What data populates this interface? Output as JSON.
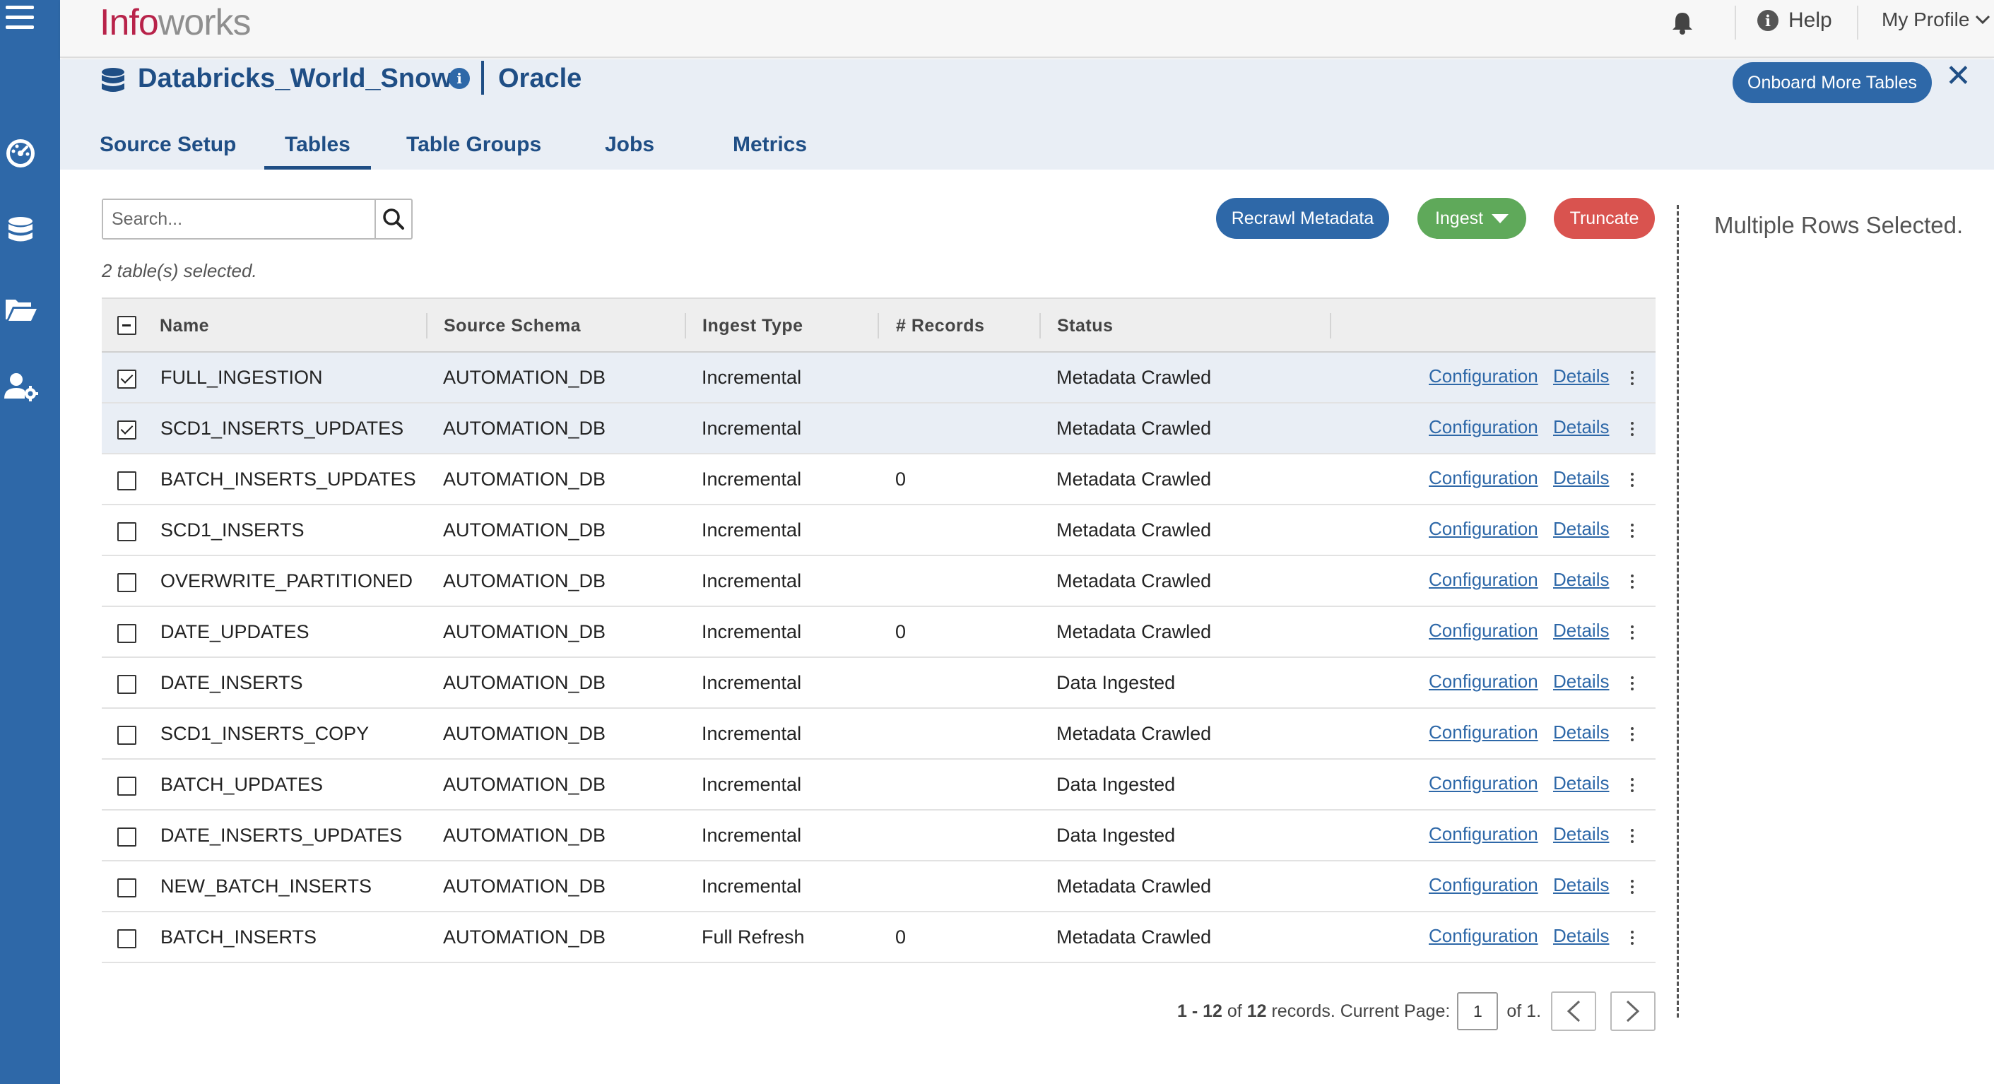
{
  "app": {
    "logo_part1": "Info",
    "logo_part2": "works"
  },
  "header": {
    "help_label": "Help",
    "profile_label": "My Profile"
  },
  "source": {
    "name": "Databricks_World_Snow",
    "type": "Oracle",
    "onboard_label": "Onboard More Tables",
    "close_label": "✕"
  },
  "tabs": [
    {
      "label": "Source Setup",
      "active": false
    },
    {
      "label": "Tables",
      "active": true
    },
    {
      "label": "Table Groups",
      "active": false
    },
    {
      "label": "Jobs",
      "active": false
    },
    {
      "label": "Metrics",
      "active": false
    }
  ],
  "toolbar": {
    "search_placeholder": "Search...",
    "selected_note": "2 table(s) selected.",
    "recrawl_label": "Recrawl Metadata",
    "ingest_label": "Ingest",
    "truncate_label": "Truncate"
  },
  "table": {
    "columns": [
      "Name",
      "Source Schema",
      "Ingest Type",
      "# Records",
      "Status"
    ],
    "config_label": "Configuration",
    "details_label": "Details",
    "rows": [
      {
        "name": "FULL_INGESTION",
        "schema": "AUTOMATION_DB",
        "ingest_type": "Incremental",
        "records": "",
        "status": "Metadata Crawled",
        "checked": true
      },
      {
        "name": "SCD1_INSERTS_UPDATES",
        "schema": "AUTOMATION_DB",
        "ingest_type": "Incremental",
        "records": "",
        "status": "Metadata Crawled",
        "checked": true
      },
      {
        "name": "BATCH_INSERTS_UPDATES",
        "schema": "AUTOMATION_DB",
        "ingest_type": "Incremental",
        "records": "0",
        "status": "Metadata Crawled",
        "checked": false
      },
      {
        "name": "SCD1_INSERTS",
        "schema": "AUTOMATION_DB",
        "ingest_type": "Incremental",
        "records": "",
        "status": "Metadata Crawled",
        "checked": false
      },
      {
        "name": "OVERWRITE_PARTITIONED",
        "schema": "AUTOMATION_DB",
        "ingest_type": "Incremental",
        "records": "",
        "status": "Metadata Crawled",
        "checked": false
      },
      {
        "name": "DATE_UPDATES",
        "schema": "AUTOMATION_DB",
        "ingest_type": "Incremental",
        "records": "0",
        "status": "Metadata Crawled",
        "checked": false
      },
      {
        "name": "DATE_INSERTS",
        "schema": "AUTOMATION_DB",
        "ingest_type": "Incremental",
        "records": "",
        "status": "Data Ingested",
        "checked": false
      },
      {
        "name": "SCD1_INSERTS_COPY",
        "schema": "AUTOMATION_DB",
        "ingest_type": "Incremental",
        "records": "",
        "status": "Metadata Crawled",
        "checked": false
      },
      {
        "name": "BATCH_UPDATES",
        "schema": "AUTOMATION_DB",
        "ingest_type": "Incremental",
        "records": "",
        "status": "Data Ingested",
        "checked": false
      },
      {
        "name": "DATE_INSERTS_UPDATES",
        "schema": "AUTOMATION_DB",
        "ingest_type": "Incremental",
        "records": "",
        "status": "Data Ingested",
        "checked": false
      },
      {
        "name": "NEW_BATCH_INSERTS",
        "schema": "AUTOMATION_DB",
        "ingest_type": "Incremental",
        "records": "",
        "status": "Metadata Crawled",
        "checked": false
      },
      {
        "name": "BATCH_INSERTS",
        "schema": "AUTOMATION_DB",
        "ingest_type": "Full Refresh",
        "records": "0",
        "status": "Metadata Crawled",
        "checked": false
      }
    ]
  },
  "pagination": {
    "range": "1 - 12",
    "of_word": "of",
    "total": "12",
    "records_text": "records. Current Page:",
    "current_page": "1",
    "page_suffix": "of 1."
  },
  "side_panel": {
    "message": "Multiple Rows Selected."
  },
  "icons": {
    "menu": "hamburger-icon",
    "dashboard": "dashboard-gauge-icon",
    "sources": "database-icon",
    "files": "folder-open-icon",
    "admin": "user-gear-icon",
    "bell": "bell-icon",
    "help": "info-icon",
    "search": "search-icon"
  },
  "colors": {
    "sidebar": "#2e68a8",
    "primary": "#2e68a8",
    "title": "#1f4e85",
    "ingest": "#5fa95a",
    "truncate": "#d9534f",
    "logo_red": "#b8234a"
  }
}
